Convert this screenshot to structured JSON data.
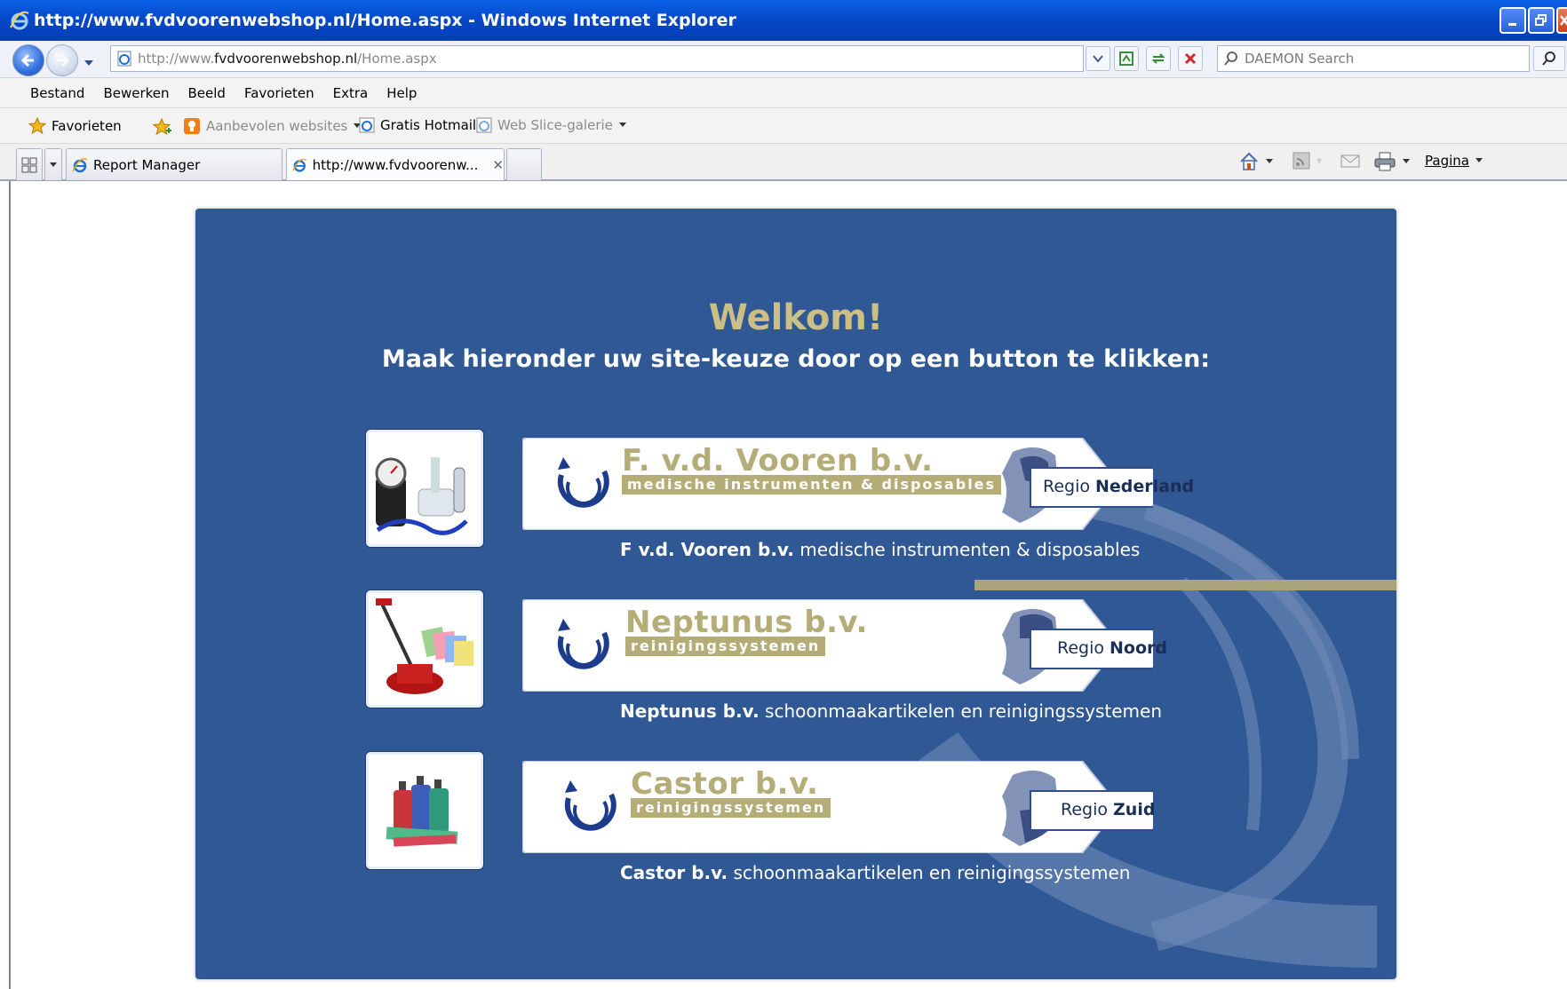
{
  "window": {
    "title": "http://www.fvdvoorenwebshop.nl/Home.aspx - Windows Internet Explorer"
  },
  "address": {
    "url_prefix": "http://www.",
    "url_domain": "fvdvoorenwebshop.nl",
    "url_path": "/Home.aspx",
    "search_placeholder": "DAEMON Search"
  },
  "menu": [
    "Bestand",
    "Bewerken",
    "Beeld",
    "Favorieten",
    "Extra",
    "Help"
  ],
  "favorites_bar": {
    "favorites_label": "Favorieten",
    "suggested_sites": "Aanbevolen websites",
    "hotmail": "Gratis Hotmail",
    "web_slice": "Web Slice-galerie"
  },
  "tabs": [
    {
      "label": "Report Manager"
    },
    {
      "label": "http://www.fvdvoorenw...",
      "close": "✕"
    }
  ],
  "command_bar": {
    "page_label": "Pagina"
  },
  "content": {
    "welcome": "Welkom!",
    "instruction": "Maak hieronder uw site-keuze door op een button te klikken:",
    "sites": [
      {
        "company": "F. v.d. Vooren b.v.",
        "tagline": "medische instrumenten & disposables",
        "regio_prefix": "Regio",
        "regio_name": "Nederland",
        "caption_bold": "F v.d. Vooren b.v.",
        "caption_rest": "medische instrumenten & disposables"
      },
      {
        "company": "Neptunus b.v.",
        "tagline": "reinigingssystemen",
        "regio_prefix": "Regio",
        "regio_name": "Noord",
        "caption_bold": "Neptunus b.v.",
        "caption_rest": "schoonmaakartikelen en reinigingssystemen"
      },
      {
        "company": "Castor b.v.",
        "tagline": "reinigingssystemen",
        "regio_prefix": "Regio",
        "regio_name": "Zuid",
        "caption_bold": "Castor b.v.",
        "caption_rest": "schoonmaakartikelen en reinigingssystemen"
      }
    ]
  },
  "colors": {
    "panel_blue": "#2f5894",
    "gold": "#cbbf86",
    "tagline_gold": "#b5ad77",
    "titlebar_blue": "#0649c9"
  }
}
